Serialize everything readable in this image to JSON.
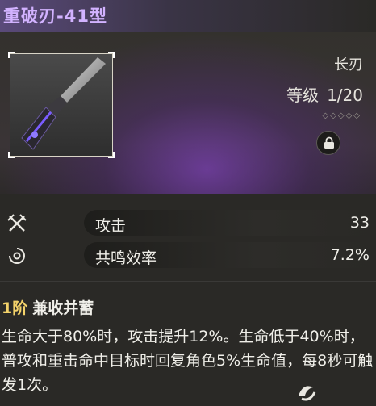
{
  "header": {
    "title": "重破刃-41型"
  },
  "weapon": {
    "type": "长刃",
    "level_label": "等级",
    "level_value": "1/20",
    "rank_dots": "◇◇◇◇◇",
    "lock_icon": "lock-icon"
  },
  "stats": [
    {
      "label": "攻击",
      "value": "33",
      "icon": "attack-icon"
    },
    {
      "label": "共鸣效率",
      "value": "7.2%",
      "icon": "energy-regen-icon"
    }
  ],
  "skill": {
    "rank": "1阶",
    "name": "兼收并蓄",
    "description": "生命大于80%时，攻击提升12%。生命低于40%时，普攻和重击命中目标时回复角色5%生命值，每8秒可触发1次。"
  },
  "colors": {
    "title": "#d2b2ff",
    "rank": "#f3d26a",
    "accent_glow": "#9646e6"
  }
}
